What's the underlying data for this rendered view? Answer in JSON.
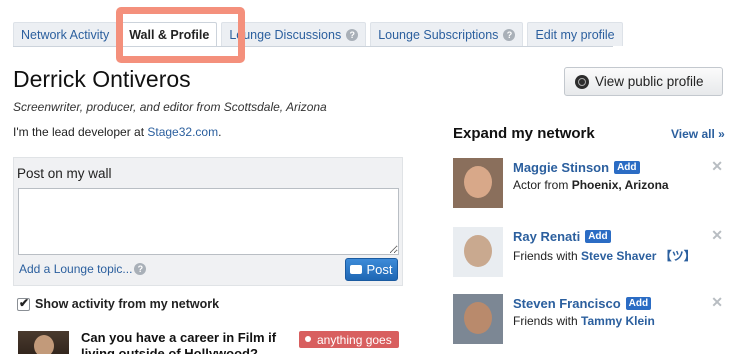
{
  "tabs": [
    {
      "label": "Network Activity",
      "help": false
    },
    {
      "label": "Wall & Profile",
      "help": false,
      "active": true
    },
    {
      "label": "Lounge Discussions",
      "help": true
    },
    {
      "label": "Lounge Subscriptions",
      "help": true
    },
    {
      "label": "Edit my profile",
      "help": false
    }
  ],
  "help_glyph": "?",
  "profile": {
    "name": "Derrick Ontiveros",
    "tagline": "Screenwriter, producer, and editor from Scottsdale, Arizona",
    "bio_prefix": "I'm the lead developer at ",
    "bio_link": "Stage32.com",
    "bio_suffix": "."
  },
  "view_public_profile": "View public profile",
  "post": {
    "label": "Post on my wall",
    "placeholder": "",
    "add_topic": "Add a Lounge topic...",
    "button": "Post"
  },
  "show_activity": "Show activity from my network",
  "feed": {
    "title": "Can you have a career in Film if living outside of Hollywood?",
    "tag": "anything goes"
  },
  "expand": {
    "title": "Expand my network",
    "view_all": "View all »",
    "add_label": "Add",
    "close_glyph": "✕",
    "people": [
      {
        "name": "Maggie Stinson",
        "sub_prefix": "Actor from ",
        "sub_value": "Phoenix, Arizona",
        "value_style": "bold",
        "face": "#d8a889"
      },
      {
        "name": "Ray Renati",
        "sub_prefix": "Friends with ",
        "sub_value": "Steve Shaver 【ツ】",
        "value_style": "link",
        "face": "#c9a98f"
      },
      {
        "name": "Steven Francisco",
        "sub_prefix": "Friends with ",
        "sub_value": "Tammy Klein",
        "value_style": "link",
        "face": "#b98a6c"
      }
    ]
  },
  "colors": {
    "link": "#2b5f9e",
    "highlight": "#f4907c",
    "post_button": "#2b6cc4",
    "tag": "#d85f5f"
  }
}
